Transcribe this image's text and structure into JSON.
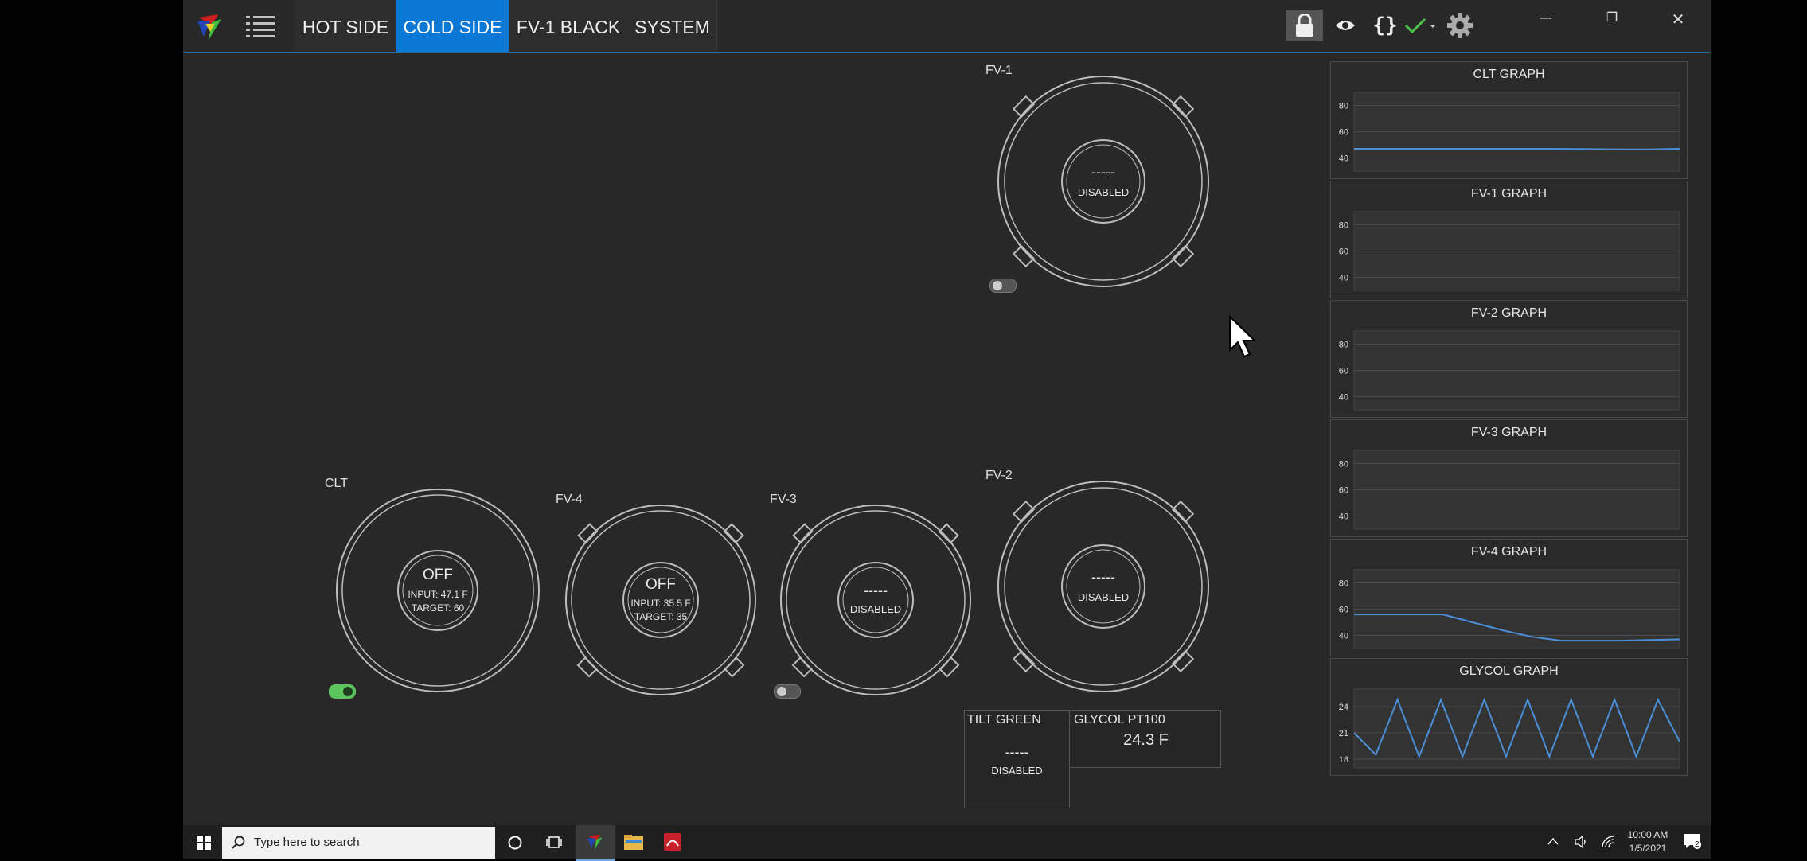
{
  "tabs": [
    {
      "label": "HOT SIDE",
      "active": false
    },
    {
      "label": "COLD SIDE",
      "active": true
    },
    {
      "label": "FV-1 BLACK",
      "active": false
    },
    {
      "label": "SYSTEM",
      "active": false
    }
  ],
  "toolbar_icons": [
    "lock-icon",
    "eye-icon",
    "braces-icon",
    "check-icon",
    "gear-icon"
  ],
  "window_controls": {
    "minimize": "─",
    "restore": "❐",
    "close": "✕"
  },
  "dials": {
    "fv1": {
      "label": "FV-1",
      "status": "-----",
      "detail": "DISABLED"
    },
    "clt": {
      "label": "CLT",
      "status": "OFF",
      "input": "INPUT: 47.1 F",
      "target": "TARGET: 60"
    },
    "fv4": {
      "label": "FV-4",
      "status": "OFF",
      "input": "INPUT: 35.5 F",
      "target": "TARGET: 35"
    },
    "fv3": {
      "label": "FV-3",
      "status": "-----",
      "detail": "DISABLED"
    },
    "fv2": {
      "label": "FV-2",
      "status": "-----",
      "detail": "DISABLED"
    }
  },
  "sensors": {
    "tilt": {
      "label": "TILT GREEN",
      "value": "-----",
      "detail": "DISABLED"
    },
    "glycol": {
      "label": "GLYCOL PT100",
      "value": "24.3 F"
    }
  },
  "graphs": [
    {
      "title": "CLT GRAPH",
      "ticks": [
        "80",
        "60",
        "40"
      ]
    },
    {
      "title": "FV-1 GRAPH",
      "ticks": [
        "80",
        "60",
        "40"
      ]
    },
    {
      "title": "FV-2 GRAPH",
      "ticks": [
        "80",
        "60",
        "40"
      ]
    },
    {
      "title": "FV-3 GRAPH",
      "ticks": [
        "80",
        "60",
        "40"
      ]
    },
    {
      "title": "FV-4 GRAPH",
      "ticks": [
        "80",
        "60",
        "40"
      ]
    },
    {
      "title": "GLYCOL GRAPH",
      "ticks": [
        "24",
        "21",
        "18"
      ]
    }
  ],
  "chart_data": [
    {
      "type": "line",
      "title": "CLT GRAPH",
      "ylim": [
        30,
        90
      ],
      "series": [
        {
          "values": [
            47,
            47,
            47,
            47,
            47,
            47,
            47,
            46.8,
            46.6,
            46.5,
            47
          ]
        }
      ]
    },
    {
      "type": "line",
      "title": "FV-1 GRAPH",
      "ylim": [
        30,
        90
      ],
      "series": []
    },
    {
      "type": "line",
      "title": "FV-2 GRAPH",
      "ylim": [
        30,
        90
      ],
      "series": []
    },
    {
      "type": "line",
      "title": "FV-3 GRAPH",
      "ylim": [
        30,
        90
      ],
      "series": []
    },
    {
      "type": "line",
      "title": "FV-4 GRAPH",
      "ylim": [
        30,
        90
      ],
      "series": [
        {
          "values": [
            56,
            56,
            56,
            56,
            50,
            44,
            39,
            36,
            36,
            36,
            36.5,
            37
          ]
        }
      ]
    },
    {
      "type": "line",
      "title": "GLYCOL GRAPH",
      "ylim": [
        17,
        26
      ],
      "series": [
        {
          "values": [
            21,
            18.5,
            24.8,
            18.3,
            24.8,
            18.3,
            24.8,
            18.3,
            24.8,
            18.3,
            24.8,
            18.3,
            24.8,
            18.3,
            24.8,
            20
          ]
        }
      ]
    }
  ],
  "taskbar": {
    "search_placeholder": "Type here to search",
    "time": "10:00 AM",
    "date": "1/5/2021",
    "notification_count": "2"
  },
  "colors": {
    "accent": "#0a78d4",
    "toggle_on": "#5cc45c",
    "line": "#4a8fd8"
  }
}
